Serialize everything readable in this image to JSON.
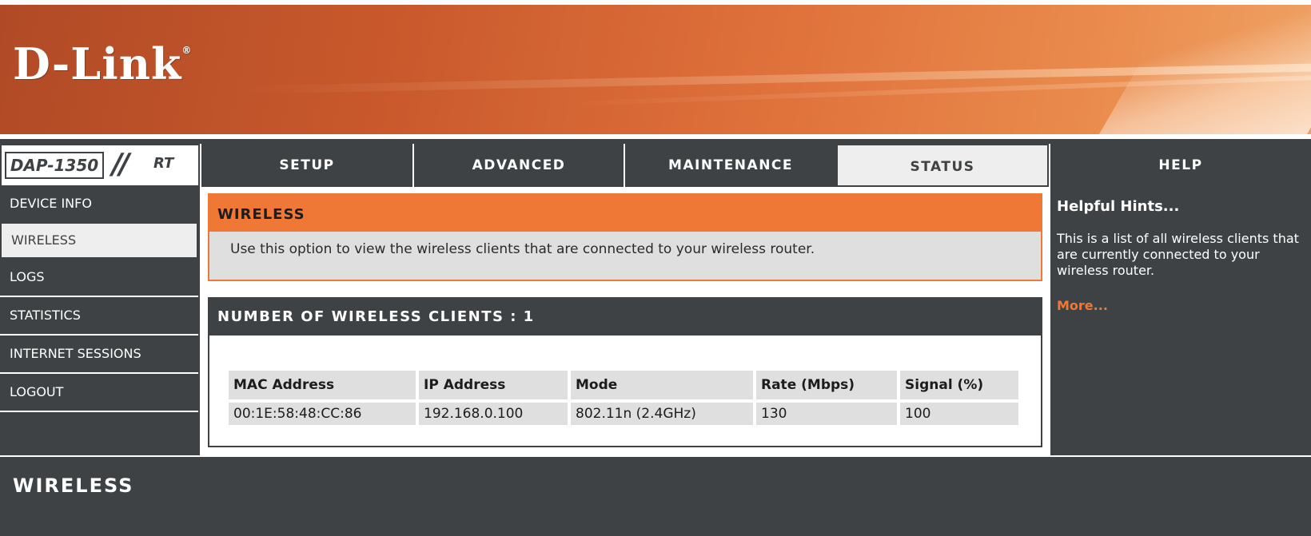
{
  "header": {
    "logo": "D-Link",
    "logo_mark": "®"
  },
  "model": {
    "name": "DAP-1350",
    "slashes": "//",
    "suffix": "RT"
  },
  "nav": {
    "tabs": [
      {
        "label": "SETUP",
        "active": false
      },
      {
        "label": "ADVANCED",
        "active": false
      },
      {
        "label": "MAINTENANCE",
        "active": false
      },
      {
        "label": "STATUS",
        "active": true
      },
      {
        "label": "HELP",
        "active": false
      }
    ]
  },
  "sidebar": {
    "items": [
      {
        "label": "DEVICE INFO",
        "active": false
      },
      {
        "label": "WIRELESS",
        "active": true
      },
      {
        "label": "LOGS",
        "active": false
      },
      {
        "label": "STATISTICS",
        "active": false
      },
      {
        "label": "INTERNET SESSIONS",
        "active": false
      },
      {
        "label": "LOGOUT",
        "active": false
      }
    ]
  },
  "main": {
    "wireless_section": {
      "title": "WIRELESS",
      "description": "Use this option to view the wireless clients that are connected to your wireless router."
    },
    "clients_section": {
      "title": "NUMBER OF WIRELESS CLIENTS  :  1",
      "columns": [
        "MAC Address",
        "IP Address",
        "Mode",
        "Rate (Mbps)",
        "Signal (%)"
      ],
      "rows": [
        [
          "00:1E:58:48:CC:86",
          "192.168.0.100",
          "802.11n (2.4GHz)",
          "130",
          "100"
        ]
      ]
    }
  },
  "hints": {
    "title": "Helpful Hints...",
    "text": "This is a list of all wireless clients that are currently connected to your wireless router.",
    "more": "More..."
  },
  "footer": {
    "label": "WIRELESS"
  },
  "colors": {
    "accent": "#f07836",
    "dark": "#3e4244",
    "panel": "#dfdfdf"
  }
}
